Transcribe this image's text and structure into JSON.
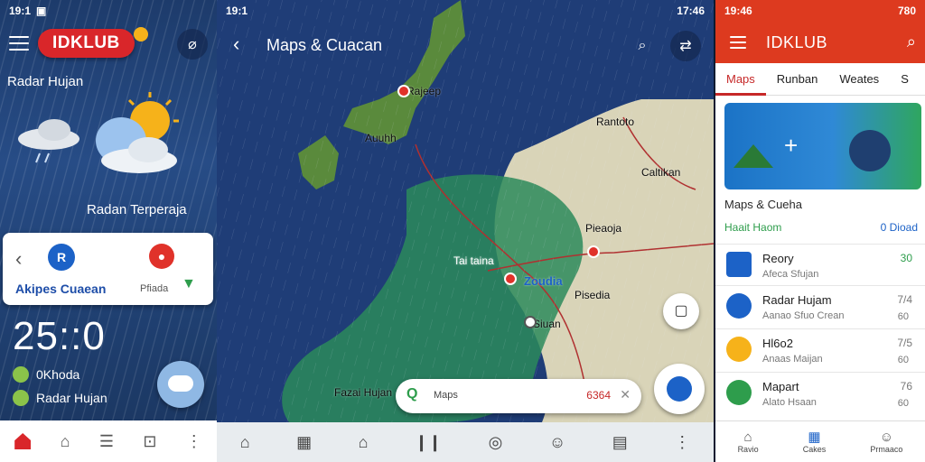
{
  "left_panel": {
    "status_time": "19:1",
    "logo": "IDKLUB",
    "radar_title": "Radar Hujan",
    "radan_label": "Radan Terperaja",
    "card": {
      "label_left": "Akipes Cuaean",
      "label_right": "Pfiada"
    },
    "clock": "25::0",
    "rows": [
      "0Khoda",
      "Radar Hujan"
    ]
  },
  "center_panel": {
    "status_time": "19:1",
    "status_right": "17:46",
    "title": "Maps & Cuacan",
    "map_labels": [
      "Rajeep",
      "Auuhh",
      "Rantoto",
      "Caltikan",
      "Pieaoja",
      "Tai taina",
      "Zoudia",
      "Pisedia",
      "Siuan",
      "Fazai Hujan"
    ],
    "search": {
      "placeholder": "Maps",
      "code": "6364"
    }
  },
  "right_panel": {
    "status_time": "19:46",
    "status_right": "780",
    "app_title": "IDKLUB",
    "tabs": [
      "Maps",
      "Runban",
      "Weates",
      "S"
    ],
    "active_tab": 0,
    "section_title": "Maps & Cueha",
    "subheader_left": "Haait Haom",
    "subheader_right": "0 Dioad",
    "items": [
      {
        "title": "Reory",
        "subtitle": "Afeca Sfujan",
        "value": "30",
        "value2": "",
        "color": "#1c62c7"
      },
      {
        "title": "Radar Hujam",
        "subtitle": "Aanao Sfuo Crean",
        "value": "7/4",
        "value2": "60",
        "color": "#1c62c7"
      },
      {
        "title": "Hl6o2",
        "subtitle": "Anaas Maijan",
        "value": "7/5",
        "value2": "60",
        "color": "#f6b21a"
      },
      {
        "title": "Mapart",
        "subtitle": "Alato Hsaan",
        "value": "76",
        "value2": "60",
        "color": "#2e9d4c"
      }
    ],
    "bottom_nav": [
      "Ravio",
      "Cakes",
      "Prmaaco"
    ]
  }
}
